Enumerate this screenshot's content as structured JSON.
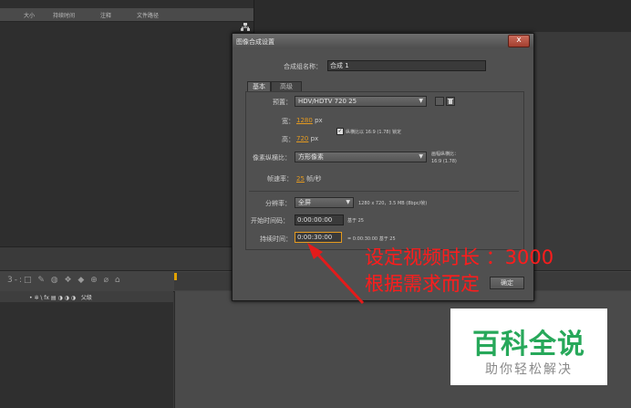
{
  "project_panel": {
    "columns": [
      "大小",
      "持续时间",
      "注释",
      "文件路径"
    ]
  },
  "timeline": {
    "tools_glyphs": "3-:□ ✎ ◍ ❖ ◆ ⊕ ⌀ ⌂",
    "switches": "• ✲ \\ fx ▤ ◑ ◑ ◑",
    "row_label": "父级"
  },
  "dialog": {
    "title": "图像合成设置",
    "close_glyph": "x",
    "comp_name_label": "合成组名称：",
    "comp_name_value": "合成 1",
    "tabs": [
      "基本",
      "高级"
    ],
    "preset_label": "预置：",
    "preset_value": "HDV/HDTV 720 25",
    "width_label": "宽：",
    "width_value": "1280",
    "height_label": "高：",
    "height_value": "720",
    "px_unit": "px",
    "lock_aspect_label": "纵横比以 16:9 (1.78) 锁定",
    "pixel_aspect_label": "像素纵横比：",
    "pixel_aspect_value": "方形像素",
    "frame_aspect_label": "画幅纵横比：",
    "frame_aspect_value": "16:9 (1.78)",
    "frame_rate_label": "帧速率：",
    "frame_rate_value": "25",
    "frame_rate_unit": "帧/秒",
    "resolution_label": "分辨率：",
    "resolution_value": "全屏",
    "resolution_info": "1280 x 720，3.5 MB (8bpc/帧)",
    "start_tc_label": "开始时间码：",
    "start_tc_value": "0:00:00:00",
    "start_tc_base": "基于 25",
    "duration_label": "持续时间：",
    "duration_value": "0:00:30:00",
    "duration_info": "= 0:00:30:00  基于 25",
    "ok_label": "确定"
  },
  "annotation": {
    "line1": "设定视频时长 ：3000",
    "line2": "根据需求而定",
    "color": "#ff1c1c"
  },
  "watermark": {
    "main": "百科全说",
    "sub": "助你轻松解决"
  }
}
